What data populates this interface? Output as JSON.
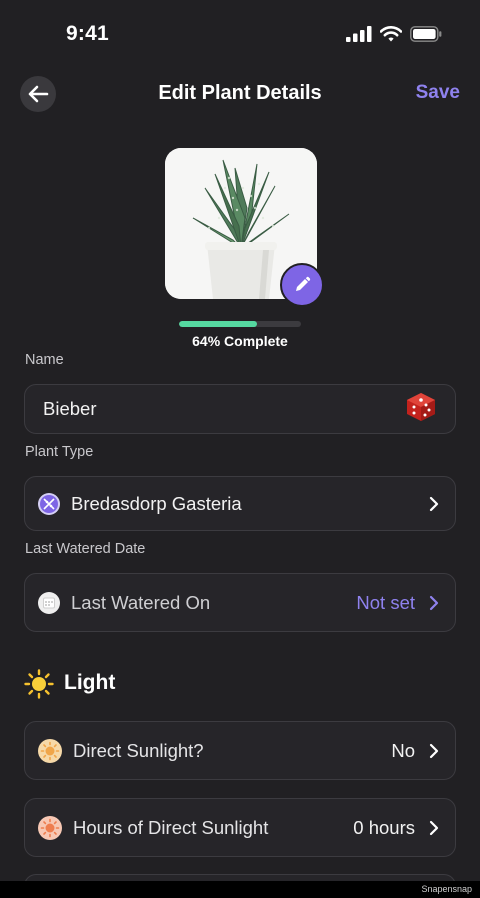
{
  "status_bar": {
    "time": "9:41"
  },
  "header": {
    "title": "Edit Plant Details",
    "save_label": "Save"
  },
  "progress": {
    "percent": 64,
    "label": "64% Complete"
  },
  "name_field": {
    "label": "Name",
    "value": "Bieber"
  },
  "plant_type_field": {
    "label": "Plant Type",
    "value": "Bredasdorp Gasteria"
  },
  "last_watered_field": {
    "label": "Last Watered Date",
    "title": "Last Watered On",
    "value": "Not set"
  },
  "light_section": {
    "title": "Light",
    "direct_sunlight": {
      "label": "Direct Sunlight?",
      "value": "No"
    },
    "hours_sunlight": {
      "label": "Hours of Direct Sunlight",
      "value": "0 hours"
    }
  },
  "watermark": "Snapensnap",
  "icons": {
    "back": "arrow-left-icon",
    "edit": "pencil-icon",
    "randomize": "dice-icon",
    "plant_type": "dna-icon",
    "calendar": "calendar-icon",
    "light": "sun-icon",
    "chevron": "chevron-right-icon"
  },
  "colors": {
    "background": "#212023",
    "accent": "#8f82ee",
    "edit_button": "#7e65e5",
    "progress": "#55d8a0",
    "field_border": "#3c3b40"
  }
}
